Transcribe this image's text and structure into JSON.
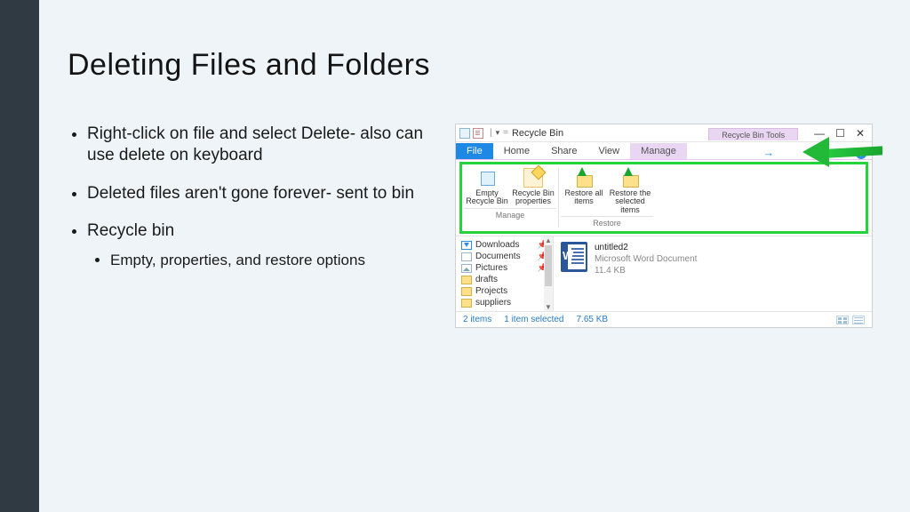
{
  "title": "Deleting Files and Folders",
  "bullets": {
    "b1": "Right-click on file and select Delete- also can use delete on keyboard",
    "b2": "Deleted files aren't gone forever- sent to bin",
    "b3": "Recycle bin",
    "b3a": "Empty, properties, and restore options"
  },
  "win": {
    "title": "Recycle Bin",
    "context_tab": "Recycle Bin Tools",
    "sep": "|",
    "tabs": {
      "file": "File",
      "home": "Home",
      "share": "Share",
      "view": "View",
      "manage": "Manage"
    },
    "help": "?",
    "ribbon": {
      "empty": "Empty Recycle Bin",
      "props": "Recycle Bin properties",
      "restall": "Restore all items",
      "restsel": "Restore the selected items",
      "grp_manage": "Manage",
      "grp_restore": "Restore"
    },
    "nav": {
      "downloads": "Downloads",
      "documents": "Documents",
      "pictures": "Pictures",
      "drafts": "drafts",
      "projects": "Projects",
      "suppliers": "suppliers"
    },
    "file": {
      "name": "untitled2",
      "type": "Microsoft Word Document",
      "size": "11.4 KB"
    },
    "status": {
      "count": "2 items",
      "sel": "1 item selected",
      "ssize": "7.65 KB"
    }
  }
}
